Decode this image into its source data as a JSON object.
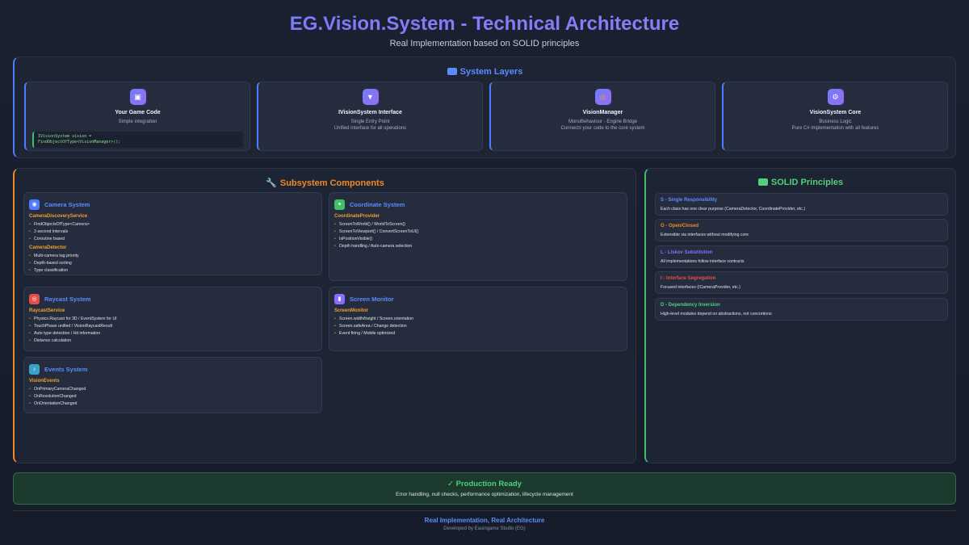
{
  "header": {
    "title": "EG.Vision.System - Technical Architecture",
    "subtitle": "Real Implementation based on SOLID principles"
  },
  "layers": {
    "title": "System Layers",
    "cards": [
      {
        "name": "Your Game Code",
        "desc1": "Simple integration",
        "desc2": "",
        "icon": "gamepad-icon",
        "code1": "IVisionSystem vision =",
        "code2": "FindObjectOfType<VisionManager>();"
      },
      {
        "name": "IVisionSystem Interface",
        "desc1": "Single Entry Point",
        "desc2": "Unified interface for all operations",
        "icon": "interface-icon"
      },
      {
        "name": "VisionManager",
        "desc1": "MonoBehaviour - Engine Bridge",
        "desc2": "Connects your code to the core system",
        "icon": "bridge-icon"
      },
      {
        "name": "VisionSystem Core",
        "desc1": "Business Logic",
        "desc2": "Pure C# implementation with all features",
        "icon": "gear-icon"
      }
    ]
  },
  "subsystems": {
    "title": "Subsystem Components",
    "camera": {
      "title": "Camera System",
      "icon": "camera-icon",
      "svc1": "CameraDiscoveryService",
      "svc1_items": [
        "FindObjectsOfType<Camera>",
        "2-second intervals",
        "Coroutine based"
      ],
      "svc2": "CameraDetector",
      "svc2_items": [
        "Multi-camera tag priority",
        "Depth-based sorting",
        "Type classification"
      ]
    },
    "coordinate": {
      "title": "Coordinate System",
      "icon": "crosshair-icon",
      "svc1": "CoordinateProvider",
      "svc1_items": [
        "ScreenToWorld() / WorldToScreen()",
        "ScreenToViewport() / ConvertScreenToUI()",
        "IsPositionVisible()",
        "Depth handling / Auto camera selection"
      ]
    },
    "raycast": {
      "title": "Raycast System",
      "icon": "target-icon",
      "svc1": "RaycastService",
      "svc1_items": [
        "Physics.Raycast for 3D / EventSystem for UI",
        "TouchPhase unified / VisionRaycastResult",
        "Auto type detection / Hit information",
        "Distance calculation"
      ]
    },
    "screen": {
      "title": "Screen Monitor",
      "icon": "monitor-icon",
      "svc1": "ScreenMonitor",
      "svc1_items": [
        "Screen.width/height / Screen.orientation",
        "Screen.safeArea / Change detection",
        "Event firing / Mobile optimized"
      ]
    },
    "events": {
      "title": "Events System",
      "icon": "bell-icon",
      "svc1": "VisionEvents",
      "svc1_items": [
        "OnPrimaryCameraChanged",
        "OnResolutionChanged",
        "OnOrientationChanged"
      ]
    }
  },
  "solid": {
    "title": "SOLID Principles",
    "items": [
      {
        "name": "S - Single Responsibility",
        "desc": "Each class has one clear purpose (CameraDetector, CoordinateProvider, etc.)",
        "color": "#5b8cff"
      },
      {
        "name": "O - Open/Closed",
        "desc": "Extensible via interfaces without modifying core",
        "color": "#f08a24"
      },
      {
        "name": "L - Liskov Substitution",
        "desc": "All implementations follow interface contracts",
        "color": "#8b6cff"
      },
      {
        "name": "I - Interface Segregation",
        "desc": "Focused interfaces (ICameraProvider, etc.)",
        "color": "#e0504a"
      },
      {
        "name": "D - Dependency Inversion",
        "desc": "High-level modules depend on abstractions, not concretions",
        "color": "#4fd07a"
      }
    ]
  },
  "production": {
    "title": "✓ Production Ready",
    "desc": "Error handling, null checks, performance optimization, lifecycle management"
  },
  "footer": {
    "line1": "Real Implementation, Real Architecture",
    "line2": "Developed by Easingame Studio (EG)"
  },
  "colors": {
    "blue": "#5b8cff",
    "orange": "#f08a24",
    "green": "#4fd07a",
    "purple": "#8b6cff",
    "red": "#e0504a"
  }
}
